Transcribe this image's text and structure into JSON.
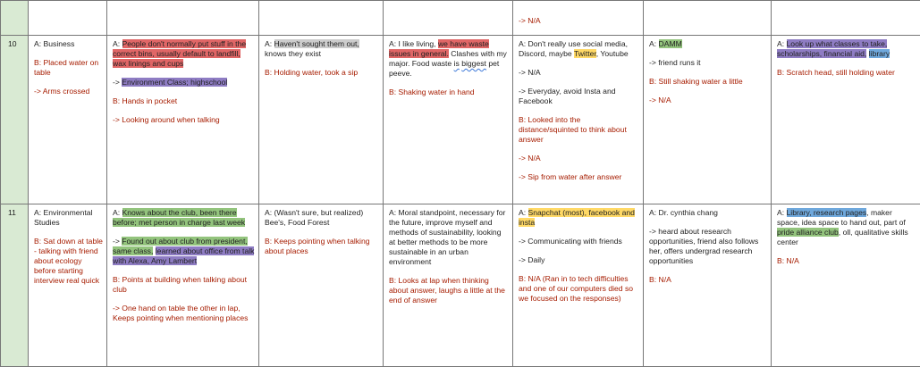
{
  "top_row": {
    "col5_text": "-> N/A"
  },
  "row10": {
    "num": "10",
    "c1": {
      "answer": "A: Business",
      "obs1": "B: Placed water on table",
      "obs2": "-> Arms crossed"
    },
    "c2": {
      "a_pre": "A: ",
      "a_hl": "People don't normally put stuff in the correct bins, usually default to landfill, wax linings and cups",
      "arrow": "-> ",
      "arrow_hl": "Environment Class; highschool",
      "obs1": "B: Hands in pocket",
      "obs2": "-> Looking around when talking"
    },
    "c3": {
      "a_pre": "A: ",
      "a_hl": "Haven't sought them out,",
      "a_post": " knows they exist",
      "obs1": "B: Holding water, took a sip"
    },
    "c4": {
      "a_pre": "A: I like living, ",
      "a_hl": "we have waste issues in general.",
      "a_post1": " Clashes with my major. Food waste ",
      "a_sq1": "is",
      "a_space": " ",
      "a_sq2": "biggest",
      "a_post2": " pet peeve.",
      "obs1": "B: Shaking water in hand"
    },
    "c5": {
      "a_pre": "A: Don't really use social media, Discord, maybe ",
      "a_hl": "Twitter",
      "a_post": ", Youtube",
      "l2": "-> N/A",
      "l3": "-> Everyday, avoid Insta and Facebook",
      "obs1": "B: Looked into the distance/squinted to think about answer",
      "obs2": "-> N/A",
      "obs3": "-> Sip from water after answer"
    },
    "c6": {
      "a_pre": "A: ",
      "a_hl": "DAMM",
      "l2": "-> friend runs it",
      "obs1": "B: Still shaking water a little",
      "obs2": "-> N/A"
    },
    "c7": {
      "a_pre": "A: ",
      "a_hl1": "Look up what classes to take, scholarships, financial aid,",
      "a_sp": " ",
      "a_hl2": "library",
      "obs1": "B: Scratch head, still holding water"
    }
  },
  "row11": {
    "num": "11",
    "c1": {
      "answer": "A: Environmental Studies",
      "obs1": "B: Sat down at table - talking with friend about ecology before starting interview real quick"
    },
    "c2": {
      "a_pre": "A: ",
      "a_hl": "Knows about the club, been there before; met person in charge last week",
      "arrow": "-> ",
      "arrow_hl1": "Found out about club from president, same class,",
      "arrow_sp": " ",
      "arrow_hl2": "learned about office from talk with Alexa, Amy Lambert",
      "obs1": "B: Points at building when talking about club",
      "obs2": "-> One hand on table the other in lap, Keeps pointing when mentioning places"
    },
    "c3": {
      "answer": "A: (Wasn't sure, but realized) Bee's, Food Forest",
      "obs1": "B: Keeps pointing when talking about places"
    },
    "c4": {
      "answer": "A: Moral standpoint, necessary for the future, improve myself and methods of sustainability, looking at better methods to be more sustainable in an urban environment",
      "obs1": "B: Looks at lap when thinking about answer, laughs a little at the end of answer"
    },
    "c5": {
      "a_pre": "A: ",
      "a_hl": "Snapchat (most), facebook and insta",
      "l2": "-> Communicating with friends",
      "l3": "-> Daily",
      "obs1": "B: N/A (Ran in to tech difficulties and one of our computers died so we focused on the responses)"
    },
    "c6": {
      "answer": "A: Dr. cynthia chang",
      "l2": "-> heard about research opportunities, friend also follows her, offers undergrad research opportunities",
      "obs1": "B: N/A"
    },
    "c7": {
      "a_pre": "A: ",
      "a_hl": "Library, research pages",
      "a_mid": ", maker space, idea space to hand out, part of ",
      "a_hl2": "pride alliance club",
      "a_post": ", oll, qualitative skills center",
      "obs1": "B: N/A"
    }
  }
}
